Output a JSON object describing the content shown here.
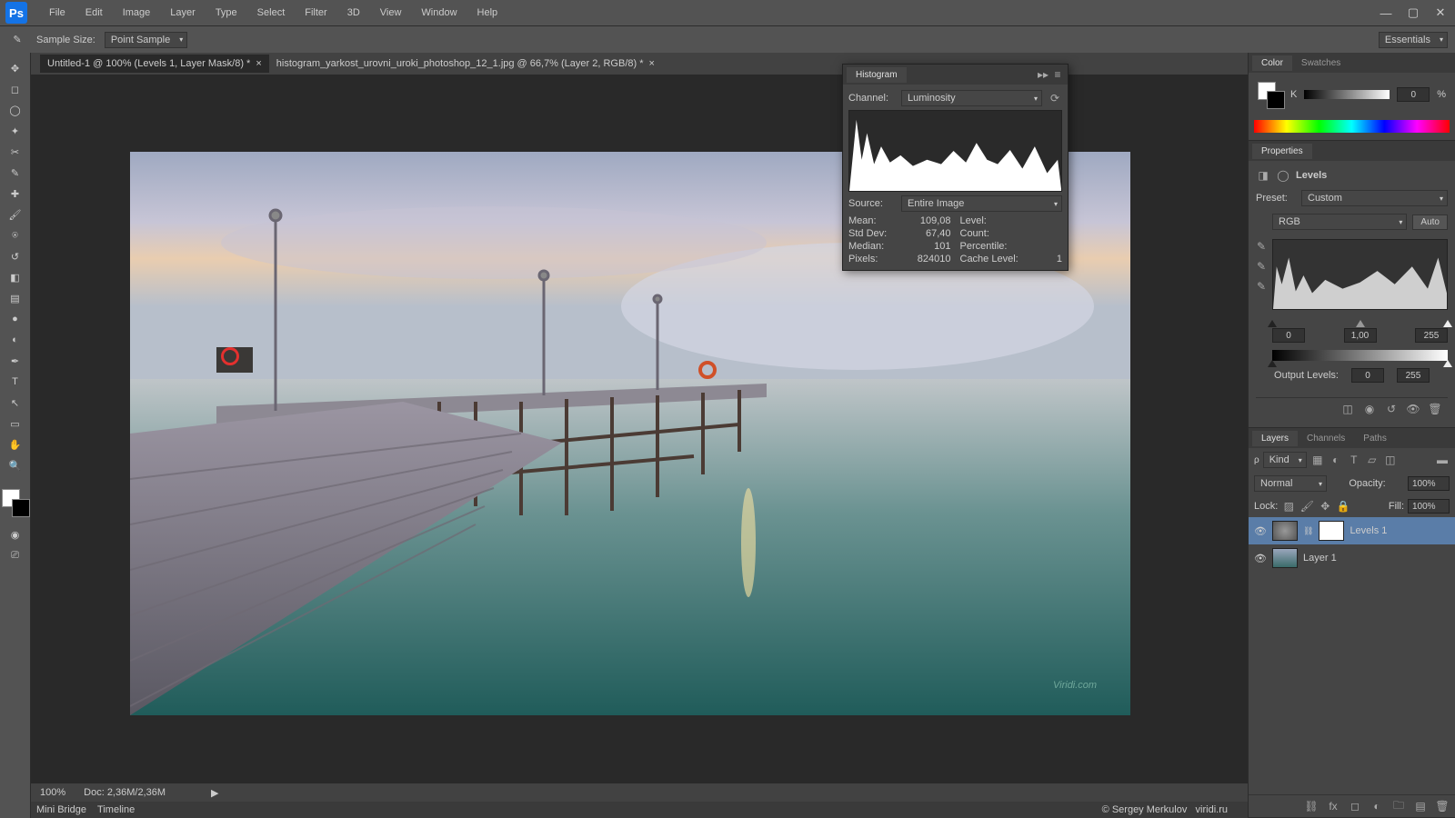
{
  "menu": [
    "File",
    "Edit",
    "Image",
    "Layer",
    "Type",
    "Select",
    "Filter",
    "3D",
    "View",
    "Window",
    "Help"
  ],
  "optionbar": {
    "sample_size_label": "Sample Size:",
    "sample_size_value": "Point Sample"
  },
  "workspace": "Essentials",
  "tabs": [
    {
      "label": "Untitled-1 @ 100% (Levels 1, Layer Mask/8) *",
      "active": true
    },
    {
      "label": "histogram_yarkost_urovni_uroki_photoshop_12_1.jpg @ 66,7% (Layer 2, RGB/8) *",
      "active": false
    }
  ],
  "status": {
    "zoom": "100%",
    "doc": "Doc: 2,36M/2,36M"
  },
  "bottom_tabs": [
    "Mini Bridge",
    "Timeline"
  ],
  "footer": {
    "credit": "© Sergey Merkulov",
    "site": "viridi.ru"
  },
  "histogram": {
    "title": "Histogram",
    "channel_label": "Channel:",
    "channel_value": "Luminosity",
    "source_label": "Source:",
    "source_value": "Entire Image",
    "stats": {
      "mean_label": "Mean:",
      "mean": "109,08",
      "std_label": "Std Dev:",
      "std": "67,40",
      "median_label": "Median:",
      "median": "101",
      "pixels_label": "Pixels:",
      "pixels": "824010",
      "level_label": "Level:",
      "level": "",
      "count_label": "Count:",
      "count": "",
      "percentile_label": "Percentile:",
      "percentile": "",
      "cache_label": "Cache Level:",
      "cache": "1"
    }
  },
  "color_panel": {
    "tabs": [
      "Color",
      "Swatches"
    ],
    "k_label": "K",
    "k_value": "0",
    "pct": "%"
  },
  "properties": {
    "title": "Properties",
    "type_label": "Levels",
    "preset_label": "Preset:",
    "preset_value": "Custom",
    "channel_value": "RGB",
    "auto_label": "Auto",
    "input_black": "0",
    "input_gamma": "1,00",
    "input_white": "255",
    "output_label": "Output Levels:",
    "output_black": "0",
    "output_white": "255"
  },
  "layers": {
    "tabs": [
      "Layers",
      "Channels",
      "Paths"
    ],
    "filter_label": "Kind",
    "blend_mode": "Normal",
    "opacity_label": "Opacity:",
    "opacity_value": "100%",
    "lock_label": "Lock:",
    "fill_label": "Fill:",
    "fill_value": "100%",
    "items": [
      {
        "name": "Levels 1",
        "selected": true,
        "adjustment": true
      },
      {
        "name": "Layer 1",
        "selected": false,
        "adjustment": false
      }
    ]
  },
  "canvas_annotation": {
    "circle_marker": true
  },
  "watermark": "Viridi.com"
}
